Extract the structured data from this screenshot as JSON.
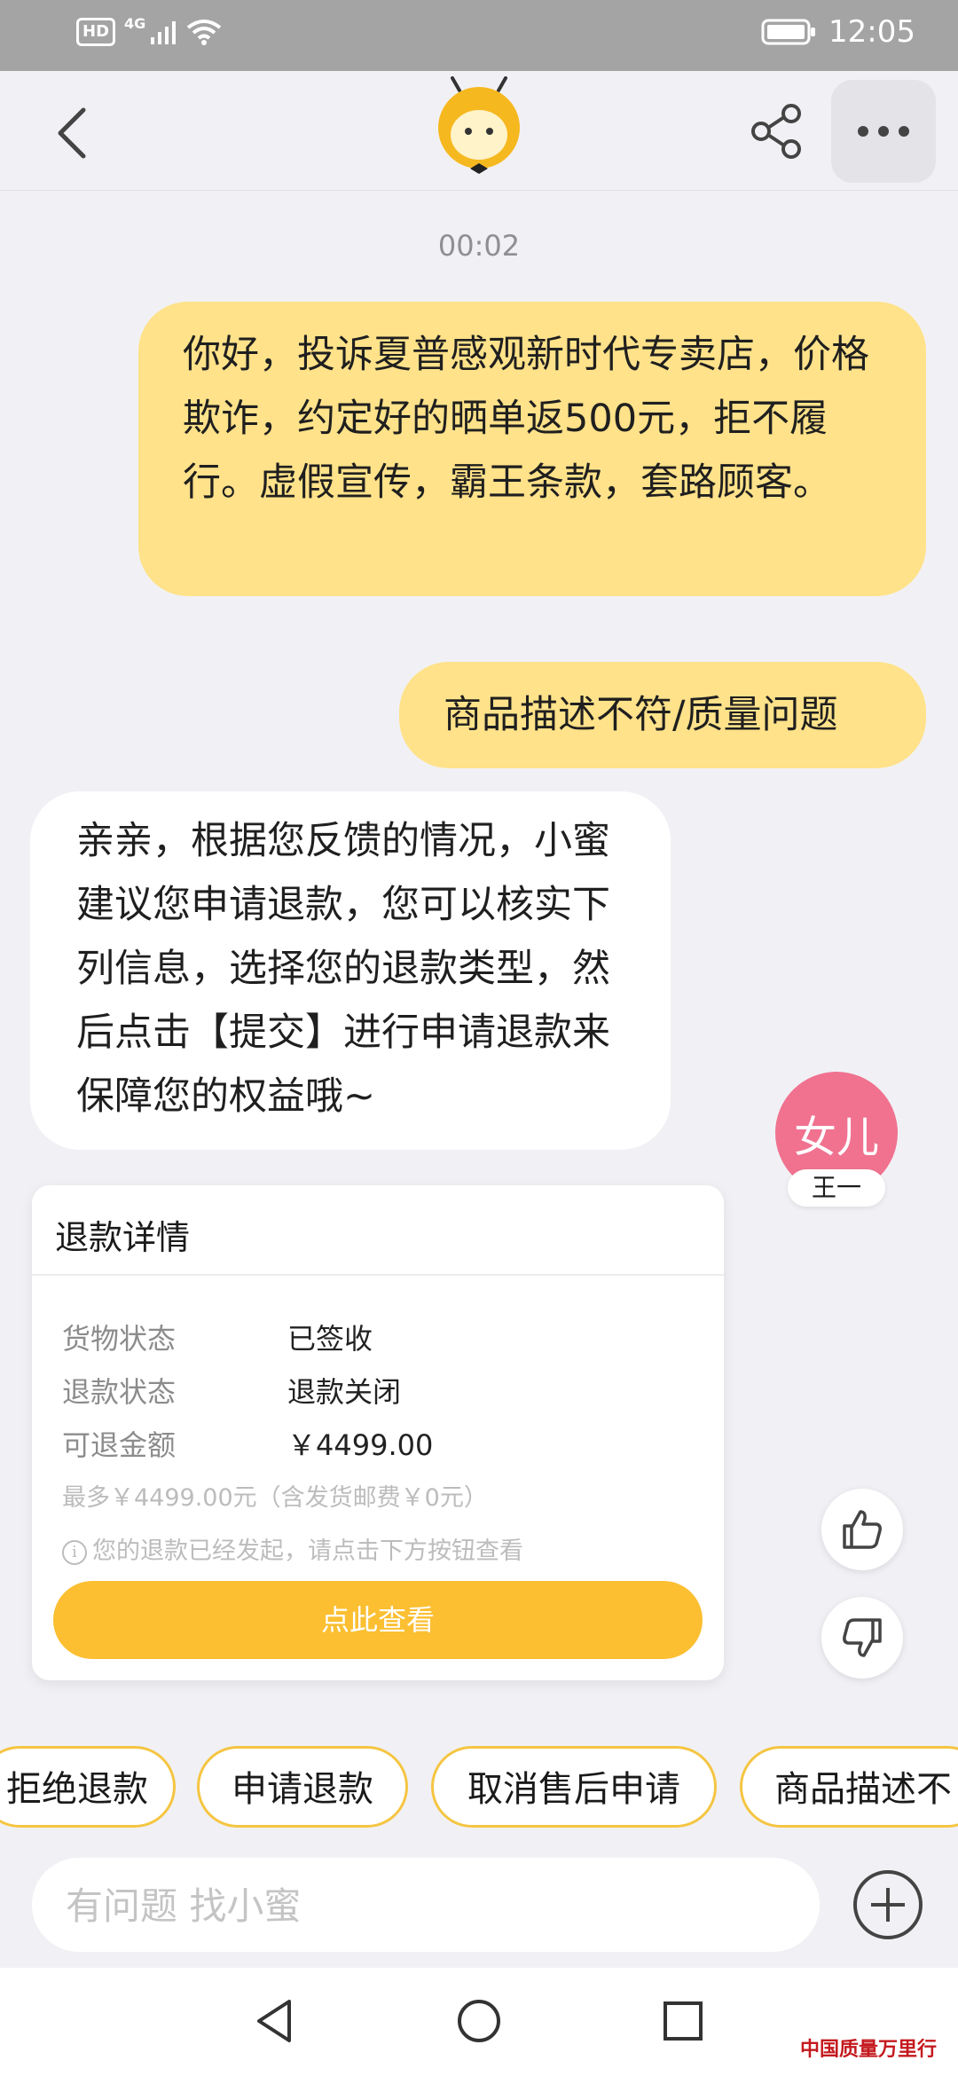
{
  "status_bar": {
    "hd": "HD",
    "network": "4G",
    "time": "12:05"
  },
  "header": {
    "logo_icon": "bee-mascot-logo"
  },
  "chat": {
    "timestamp": "00:02",
    "messages": [
      {
        "from": "user",
        "text": "你好，投诉夏普感观新时代专卖店，价格欺诈，约定好的晒单返500元，拒不履行。虚假宣传，霸王条款，套路顾客。"
      },
      {
        "from": "user",
        "text": "商品描述不符/质量问题"
      },
      {
        "from": "bot",
        "text": "亲亲，根据您反馈的情况，小蜜建议您申请退款，您可以核实下列信息，选择您的退款类型，然后点击【提交】进行申请退款来保障您的权益哦~"
      }
    ],
    "avatar": {
      "text": "女儿",
      "name": "王一",
      "color": "#f0728f"
    }
  },
  "refund_card": {
    "title": "退款详情",
    "rows": [
      {
        "label": "货物状态",
        "value": "已签收"
      },
      {
        "label": "退款状态",
        "value": "退款关闭"
      },
      {
        "label": "可退金额",
        "value": "￥4499.00"
      }
    ],
    "max_note": "最多￥4499.00元（含发货邮费￥0元）",
    "info_note": "您的退款已经发起，请点击下方按钮查看",
    "button_label": "点此查看"
  },
  "quick_replies": [
    "拒绝退款",
    "申请退款",
    "取消售后申请",
    "商品描述不"
  ],
  "input": {
    "placeholder": "有问题 找小蜜"
  },
  "watermark": "中国质量万里行",
  "colors": {
    "accent": "#fbbf31",
    "user_bubble": "#ffe28a",
    "chip_border": "#f5c542"
  }
}
